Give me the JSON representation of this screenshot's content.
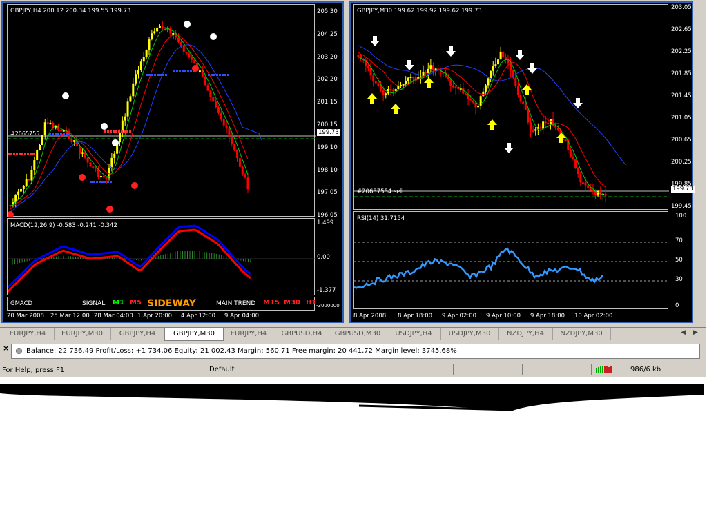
{
  "left_chart": {
    "title": "GBPJPY,H4  200.12 200.34 199.55 199.73",
    "price_scale": [
      "205.30",
      "204.25",
      "203.20",
      "202.20",
      "201.15",
      "200.15",
      "199.10",
      "198.10",
      "197.05",
      "196.05"
    ],
    "current_price": "199.73",
    "order_label": "#2065755",
    "macd_label": "MACD(12,26,9) -0.583 -0.241 -0.342",
    "macd_scale": [
      "1.499",
      "0.00",
      "-1.377"
    ],
    "gmacd": {
      "name": "GMACD",
      "signal_label": "SIGNAL",
      "m1": "M1",
      "m5": "M5",
      "sideway": "SIDEWAY",
      "main_trend": "MAIN TREND",
      "m15": "M15",
      "m30": "M30",
      "h1": "H1",
      "scale": "-3000000"
    },
    "dates": [
      "20 Mar 2008",
      "25 Mar 12:00",
      "28 Mar 04:00",
      "1 Apr 20:00",
      "4 Apr 12:00",
      "9 Apr 04:00"
    ]
  },
  "right_chart": {
    "title": "GBPJPY,M30  199.62 199.92 199.62 199.73",
    "price_scale": [
      "203.05",
      "202.65",
      "202.25",
      "201.85",
      "201.45",
      "201.05",
      "200.65",
      "200.25",
      "199.85",
      "199.45"
    ],
    "current_price": "199.73",
    "order_label": "#20657554 sell",
    "rsi_label": "RSI(14) 31.7154",
    "rsi_scale": [
      "100",
      "70",
      "50",
      "30",
      "0"
    ],
    "dates": [
      "8 Apr 2008",
      "8 Apr 18:00",
      "9 Apr 02:00",
      "9 Apr 10:00",
      "9 Apr 18:00",
      "10 Apr 02:00"
    ]
  },
  "tabs": [
    "EURJPY,H4",
    "EURJPY,M30",
    "GBPJPY,H4",
    "GBPJPY,M30",
    "EURJPY,H4",
    "GBPUSD,H4",
    "GBPUSD,M30",
    "USDJPY,H4",
    "USDJPY,M30",
    "NZDJPY,H4",
    "NZDJPY,M30"
  ],
  "active_tab": "GBPJPY,M30",
  "terminal": {
    "close": "×",
    "summary": "Balance: 22 736.49  Profit/Loss: +1 734.06  Equity: 21 002.43  Margin: 560.71  Free margin: 20 441.72  Margin level: 3745.68%"
  },
  "statusbar": {
    "help": "For Help, press F1",
    "profile": "Default",
    "traffic": "986/6 kb"
  },
  "colors": {
    "bull_candle": "#ffff00",
    "bear_candle": "#ff0000",
    "macd_main": "#0000ff",
    "macd_signal": "#ff0000",
    "rsi_line": "#3399ff",
    "ma_green": "#00cc00",
    "ma_red": "#ff0000",
    "ma_blue": "#2040ff",
    "up_arrow": "#ffff00",
    "down_arrow": "#ffffff"
  }
}
